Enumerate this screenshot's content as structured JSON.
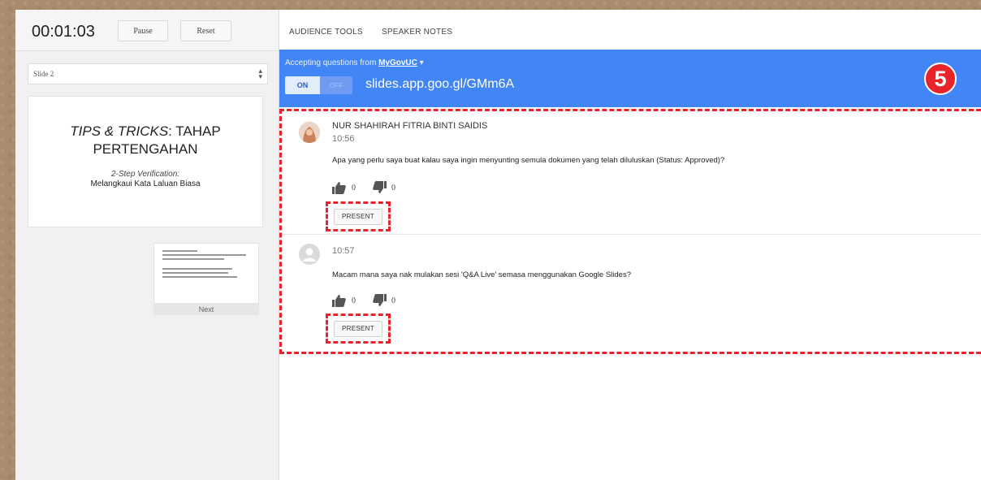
{
  "timer": {
    "time": "00:01:03",
    "pause_label": "Pause",
    "reset_label": "Reset"
  },
  "slide_selector": {
    "value": "Slide 2"
  },
  "current_slide": {
    "title_italic": "TIPS & TRICKS",
    "title_rest": ": TAHAP PERTENGAHAN",
    "subtitle_italic": "2-Step Verification:",
    "subtitle": "Melangkaui Kata Laluan Biasa"
  },
  "next_slide": {
    "label": "Next"
  },
  "tabs": [
    {
      "label": "AUDIENCE TOOLS"
    },
    {
      "label": "SPEAKER NOTES"
    }
  ],
  "banner": {
    "accepting_prefix": "Accepting questions from",
    "group": "MyGovUC",
    "toggle_on": "ON",
    "toggle_off": "OFF",
    "url": "slides.app.goo.gl/GMm6A",
    "step_badge": "5",
    "color": "#4285f4"
  },
  "questions": [
    {
      "author": "NUR SHAHIRAH FITRIA BINTI SAIDIS",
      "time": "10:56",
      "text": "Apa yang perlu saya buat kalau saya ingin menyunting semula dokumen yang telah diluluskan (Status: Approved)?",
      "upvotes": "0",
      "downvotes": "0",
      "present_label": "PRESENT"
    },
    {
      "author": "",
      "time": "10:57",
      "text": "Macam mana saya nak mulakan sesi 'Q&A Live' semasa menggunakan Google Slides?",
      "upvotes": "0",
      "downvotes": "0",
      "present_label": "PRESENT"
    }
  ],
  "highlight_color": "#e8222a"
}
